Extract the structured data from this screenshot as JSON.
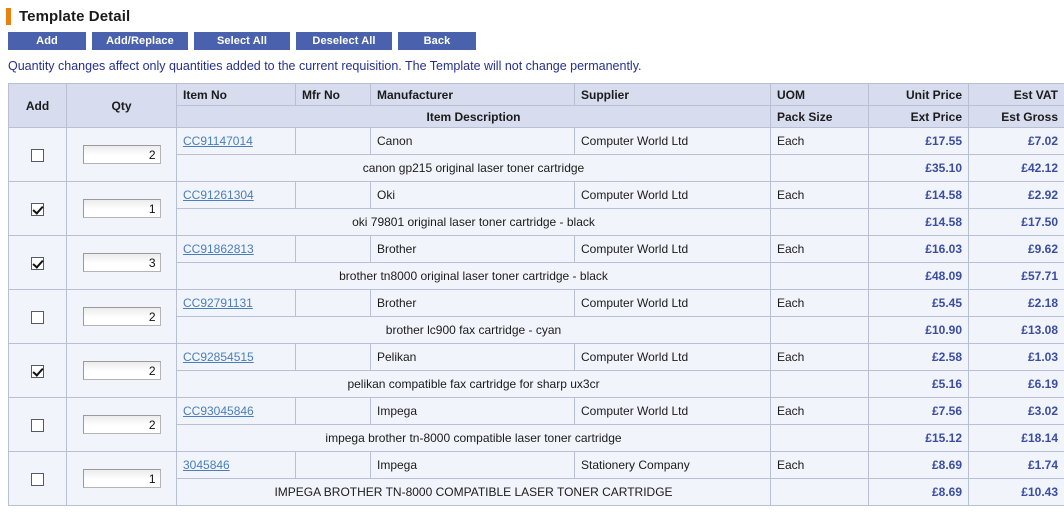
{
  "page": {
    "title": "Template Detail",
    "accent_bar_color": "#e8820c",
    "button_color": "#4a62ae",
    "link_color": "#4a7ebb",
    "money_color": "#3a4da0",
    "header_bg": "#d7dcee",
    "row_bg": "#f1f4fa",
    "instruction": "Quantity changes affect only quantities added to the current requisition. The Template will not change permanently."
  },
  "toolbar": {
    "buttons": [
      {
        "label": "Add",
        "name": "add-button"
      },
      {
        "label": "Add/Replace",
        "name": "add-replace-button"
      },
      {
        "label": "Select All",
        "name": "select-all-button"
      },
      {
        "label": "Deselect All",
        "name": "deselect-all-button"
      },
      {
        "label": "Back",
        "name": "back-button"
      }
    ]
  },
  "table": {
    "headers_row1": {
      "add": "Add",
      "qty": "Qty",
      "item_no": "Item No",
      "mfr_no": "Mfr No",
      "manufacturer": "Manufacturer",
      "supplier": "Supplier",
      "uom": "UOM",
      "unit_price": "Unit Price",
      "est_vat": "Est VAT"
    },
    "headers_row2": {
      "item_description": "Item Description",
      "pack_size": "Pack Size",
      "ext_price": "Ext Price",
      "est_gross": "Est Gross"
    },
    "rows": [
      {
        "checked": false,
        "qty": "2",
        "item_no": "CC91147014",
        "mfr_no": "",
        "manufacturer": "Canon",
        "supplier": "Computer World Ltd",
        "uom": "Each",
        "unit_price": "£17.55",
        "est_vat": "£7.02",
        "description": "canon gp215 original laser toner cartridge",
        "pack_size": "",
        "ext_price": "£35.10",
        "est_gross": "£42.12"
      },
      {
        "checked": true,
        "qty": "1",
        "item_no": "CC91261304",
        "mfr_no": "",
        "manufacturer": "Oki",
        "supplier": "Computer World Ltd",
        "uom": "Each",
        "unit_price": "£14.58",
        "est_vat": "£2.92",
        "description": "oki 79801 original laser toner cartridge - black",
        "pack_size": "",
        "ext_price": "£14.58",
        "est_gross": "£17.50"
      },
      {
        "checked": true,
        "qty": "3",
        "item_no": "CC91862813",
        "mfr_no": "",
        "manufacturer": "Brother",
        "supplier": "Computer World Ltd",
        "uom": "Each",
        "unit_price": "£16.03",
        "est_vat": "£9.62",
        "description": "brother tn8000 original laser toner cartridge - black",
        "pack_size": "",
        "ext_price": "£48.09",
        "est_gross": "£57.71"
      },
      {
        "checked": false,
        "qty": "2",
        "item_no": "CC92791131",
        "mfr_no": "",
        "manufacturer": "Brother",
        "supplier": "Computer World Ltd",
        "uom": "Each",
        "unit_price": "£5.45",
        "est_vat": "£2.18",
        "description": "brother lc900 fax cartridge - cyan",
        "pack_size": "",
        "ext_price": "£10.90",
        "est_gross": "£13.08"
      },
      {
        "checked": true,
        "qty": "2",
        "item_no": "CC92854515",
        "mfr_no": "",
        "manufacturer": "Pelikan",
        "supplier": "Computer World Ltd",
        "uom": "Each",
        "unit_price": "£2.58",
        "est_vat": "£1.03",
        "description": "pelikan compatible fax cartridge for sharp ux3cr",
        "pack_size": "",
        "ext_price": "£5.16",
        "est_gross": "£6.19"
      },
      {
        "checked": false,
        "qty": "2",
        "item_no": "CC93045846",
        "mfr_no": "",
        "manufacturer": "Impega",
        "supplier": "Computer World Ltd",
        "uom": "Each",
        "unit_price": "£7.56",
        "est_vat": "£3.02",
        "description": "impega brother tn-8000 compatible laser toner cartridge",
        "pack_size": "",
        "ext_price": "£15.12",
        "est_gross": "£18.14"
      },
      {
        "checked": false,
        "qty": "1",
        "item_no": "3045846",
        "mfr_no": "",
        "manufacturer": "Impega",
        "supplier": "Stationery Company",
        "uom": "Each",
        "unit_price": "£8.69",
        "est_vat": "£1.74",
        "description": "IMPEGA BROTHER TN-8000 COMPATIBLE LASER TONER CARTRIDGE",
        "pack_size": "",
        "ext_price": "£8.69",
        "est_gross": "£10.43"
      }
    ]
  }
}
